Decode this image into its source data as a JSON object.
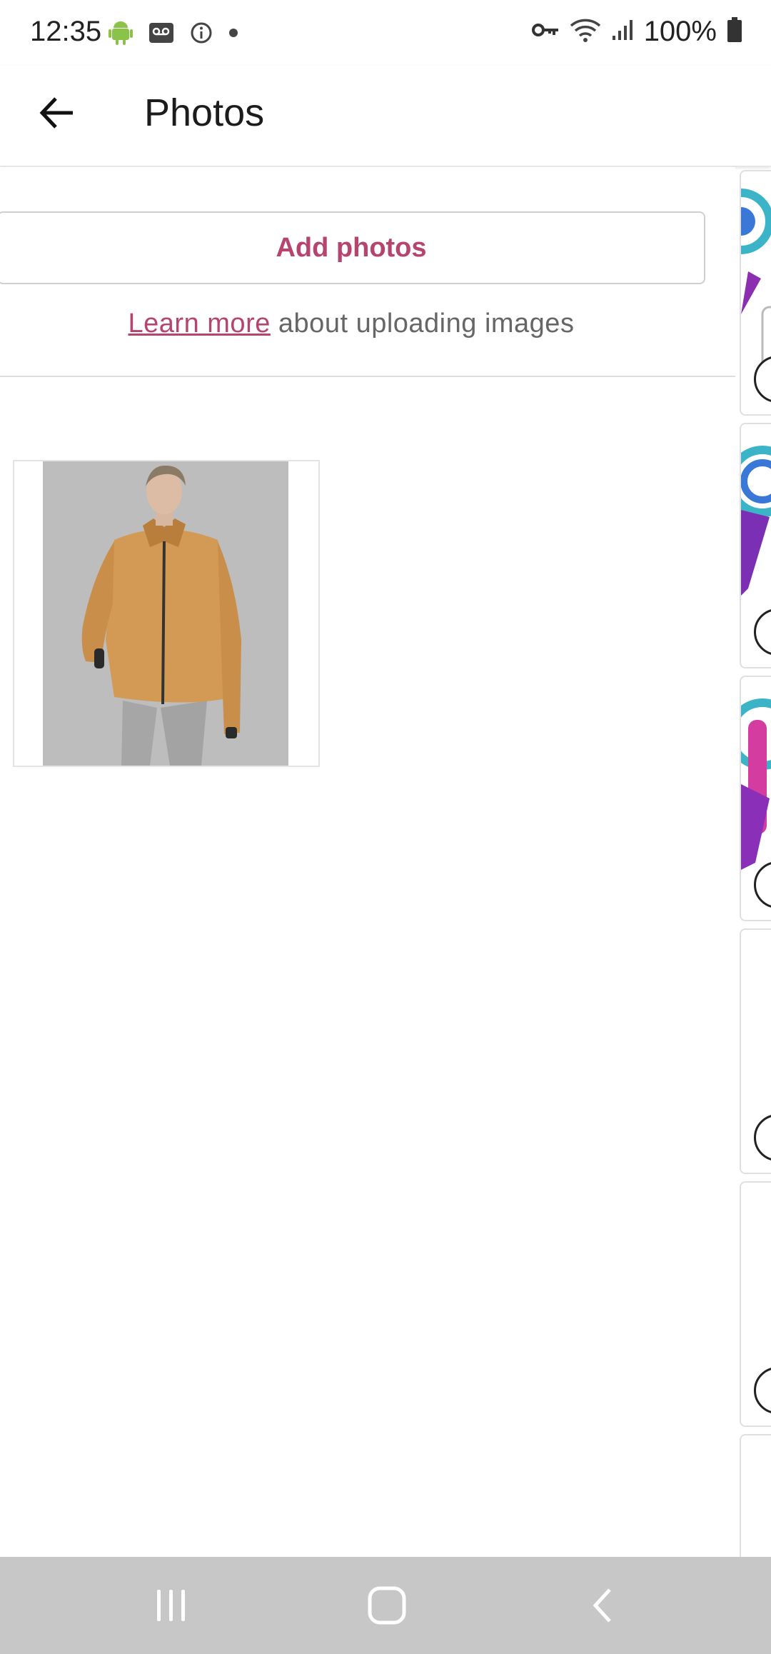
{
  "status_bar": {
    "time": "12:35",
    "left_icons": [
      "android-icon",
      "voicemail-icon",
      "info-icon",
      "dot-icon"
    ],
    "right_icons": [
      "vpn-key-icon",
      "wifi-icon",
      "signal-icon",
      "battery-icon"
    ],
    "battery": "100%"
  },
  "app_bar": {
    "back_icon": "arrow-back-icon",
    "title": "Photos"
  },
  "main": {
    "add_button_label": "Add photos",
    "learn_more_link": "Learn more",
    "learn_more_suffix": " about uploading images",
    "photos": [
      {
        "description_icon": "product-photo-jacket"
      }
    ]
  },
  "colors": {
    "accent": "#b5456f",
    "nav_bar": "#c7c7c7"
  },
  "nav_bar": {
    "buttons": [
      "recents-icon",
      "home-icon",
      "back-icon"
    ]
  }
}
